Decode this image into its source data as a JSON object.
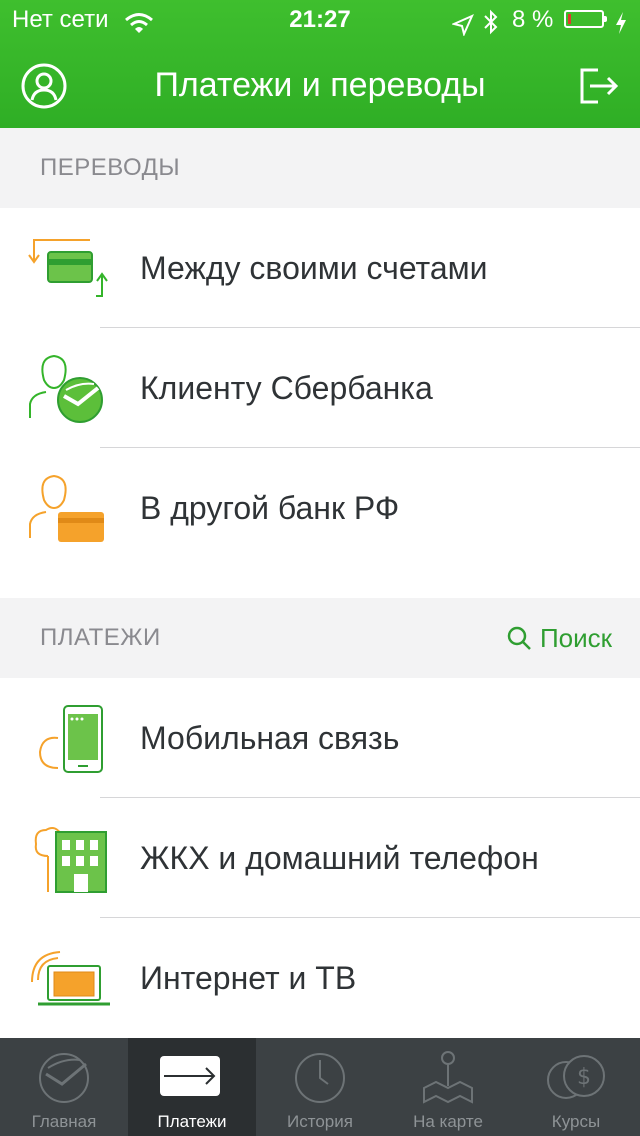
{
  "status_bar": {
    "carrier": "Нет сети",
    "time": "21:27",
    "battery_text": "8 %",
    "battery_level": 0.08
  },
  "header": {
    "title": "Платежи и переводы",
    "profile_icon": "user-icon",
    "logout_icon": "logout-icon"
  },
  "transfers": {
    "title": "ПЕРЕВОДЫ",
    "items": [
      {
        "label": "Между своими счетами",
        "icon": "own-accounts-transfer-icon"
      },
      {
        "label": "Клиенту Сбербанка",
        "icon": "sberbank-client-icon"
      },
      {
        "label": "В другой банк РФ",
        "icon": "other-bank-icon"
      }
    ]
  },
  "payments": {
    "title": "ПЛАТЕЖИ",
    "search_label": "Поиск",
    "items": [
      {
        "label": "Мобильная связь",
        "icon": "mobile-phone-icon"
      },
      {
        "label": "ЖКХ и домашний телефон",
        "icon": "utilities-building-icon"
      },
      {
        "label": "Интернет и ТВ",
        "icon": "laptop-icon"
      }
    ]
  },
  "tabbar": {
    "active": "Платежи",
    "tabs": [
      {
        "label": "Главная",
        "icon": "sberbank-logo-icon"
      },
      {
        "label": "Платежи",
        "icon": "arrow-right-icon"
      },
      {
        "label": "История",
        "icon": "clock-icon"
      },
      {
        "label": "На карте",
        "icon": "map-pin-icon"
      },
      {
        "label": "Курсы",
        "icon": "currency-icon"
      }
    ]
  },
  "colors": {
    "brand_green": "#34b42a",
    "accent_green": "#2f9e31",
    "orange": "#f5a22b",
    "tabbar_bg": "#3c4144"
  }
}
